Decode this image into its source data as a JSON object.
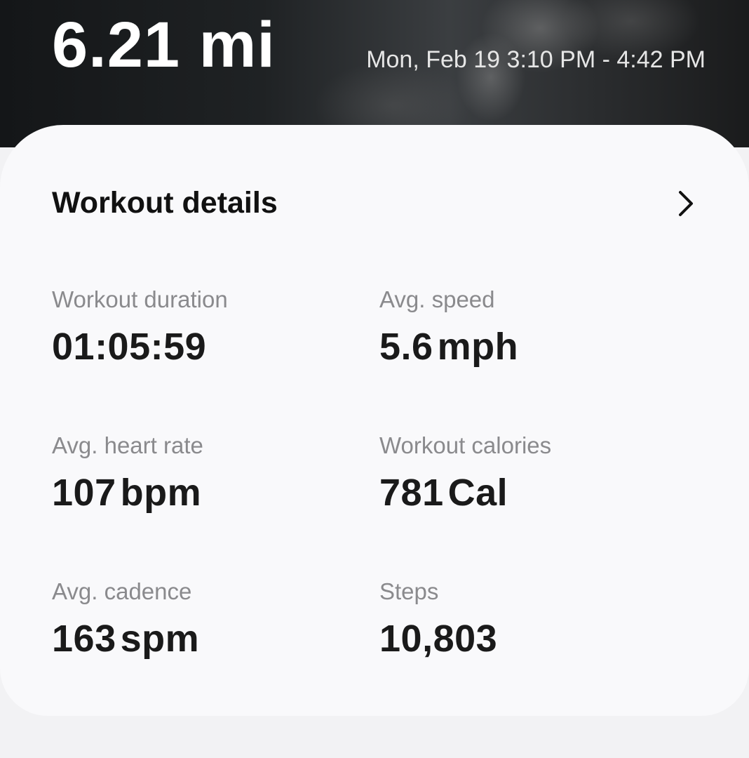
{
  "header": {
    "distance": "6.21 mi",
    "date_range": "Mon, Feb 19 3:10 PM - 4:42 PM"
  },
  "card": {
    "title": "Workout details",
    "open_icon": "chevron-right-icon",
    "stats": {
      "duration": {
        "label": "Workout duration",
        "value": "01:05:59",
        "unit": ""
      },
      "speed": {
        "label": "Avg. speed",
        "value": "5.6",
        "unit": "mph"
      },
      "heart_rate": {
        "label": "Avg. heart rate",
        "value": "107",
        "unit": "bpm"
      },
      "calories": {
        "label": "Workout calories",
        "value": "781",
        "unit": "Cal"
      },
      "cadence": {
        "label": "Avg. cadence",
        "value": "163",
        "unit": "spm"
      },
      "steps": {
        "label": "Steps",
        "value": "10,803",
        "unit": ""
      }
    }
  }
}
